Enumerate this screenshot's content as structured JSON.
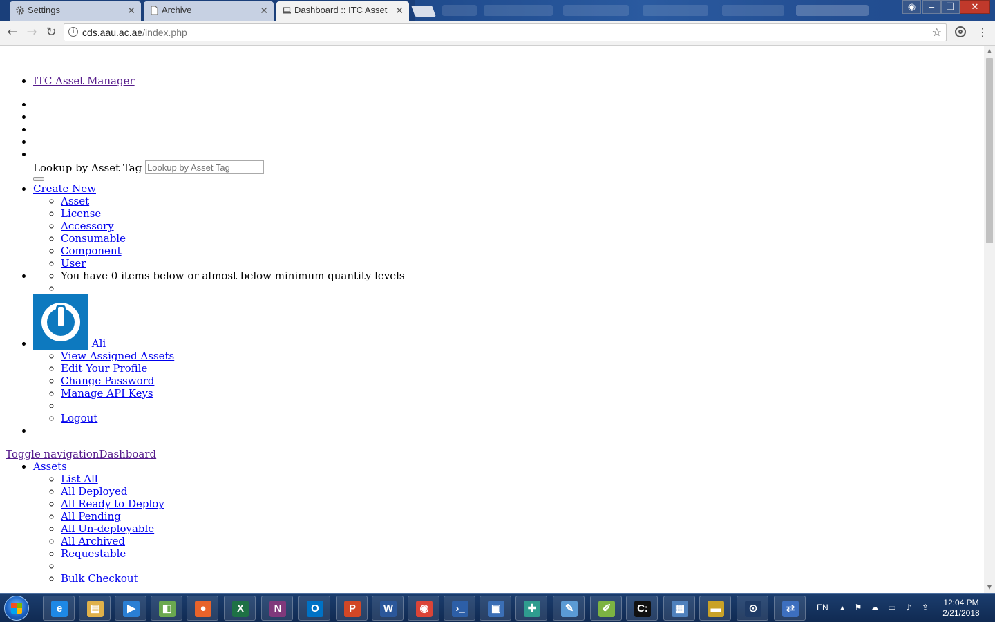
{
  "browser": {
    "tabs": [
      {
        "title": "Settings",
        "icon": "gear-icon",
        "active": false
      },
      {
        "title": "Archive",
        "icon": "document-icon",
        "active": false
      },
      {
        "title": "Dashboard :: ITC Asset M",
        "icon": "laptop-icon",
        "active": true
      }
    ],
    "url_host": "cds.aau.ac.ae",
    "url_path": "/index.php"
  },
  "page": {
    "brand": "ITC Asset Manager",
    "lookup": {
      "label": "Lookup by Asset Tag",
      "placeholder": "Lookup by Asset Tag"
    },
    "create_new": {
      "label": "Create New",
      "items": [
        "Asset",
        "License",
        "Accessory",
        "Consumable",
        "Component",
        "User"
      ]
    },
    "alerts_text": "You have 0 items below or almost below minimum quantity levels",
    "user": {
      "name": "Ali",
      "menu": [
        "View Assigned Assets",
        "Edit Your Profile",
        "Change Password",
        "Manage API Keys"
      ],
      "logout": "Logout"
    },
    "toggle_nav": "Toggle navigation",
    "dashboard": "Dashboard",
    "assets": {
      "label": "Assets",
      "items": [
        "List All",
        "All Deployed",
        "All Ready to Deploy",
        "All Pending",
        "All Un-deployable",
        "All Archived",
        "Requestable"
      ],
      "bulk_checkout": "Bulk Checkout"
    }
  },
  "taskbar": {
    "language": "EN",
    "time": "12:04 PM",
    "date": "2/21/2018",
    "apps": [
      {
        "name": "internet-explorer",
        "glyph": "e",
        "color": "#1e88e5"
      },
      {
        "name": "file-explorer",
        "glyph": "▤",
        "color": "#e0b14a"
      },
      {
        "name": "media-player",
        "glyph": "▶",
        "color": "#2a7fd4"
      },
      {
        "name": "vsphere-client",
        "glyph": "◧",
        "color": "#6aa84f"
      },
      {
        "name": "firefox",
        "glyph": "●",
        "color": "#e8632a"
      },
      {
        "name": "excel",
        "glyph": "X",
        "color": "#1e7145"
      },
      {
        "name": "onenote",
        "glyph": "N",
        "color": "#80397b"
      },
      {
        "name": "outlook",
        "glyph": "O",
        "color": "#0072c6"
      },
      {
        "name": "powerpoint",
        "glyph": "P",
        "color": "#d24726"
      },
      {
        "name": "word",
        "glyph": "W",
        "color": "#2b579a"
      },
      {
        "name": "chrome",
        "glyph": "◉",
        "color": "#db4437"
      },
      {
        "name": "powershell",
        "glyph": "›_",
        "color": "#2d5fa7"
      },
      {
        "name": "remote-desktop",
        "glyph": "▣",
        "color": "#3b6fb6"
      },
      {
        "name": "network-tool",
        "glyph": "✚",
        "color": "#2f9c8f"
      },
      {
        "name": "paint",
        "glyph": "✎",
        "color": "#5b9bd5"
      },
      {
        "name": "notepad-plus",
        "glyph": "✐",
        "color": "#7cb342"
      },
      {
        "name": "command-prompt",
        "glyph": "C:",
        "color": "#111111"
      },
      {
        "name": "control-panel",
        "glyph": "▦",
        "color": "#4f81bd"
      },
      {
        "name": "scanner",
        "glyph": "▬",
        "color": "#c9a227"
      },
      {
        "name": "keepass",
        "glyph": "⊙",
        "color": "#1f3b66"
      },
      {
        "name": "network-connections",
        "glyph": "⇄",
        "color": "#3d6fbf"
      }
    ]
  }
}
